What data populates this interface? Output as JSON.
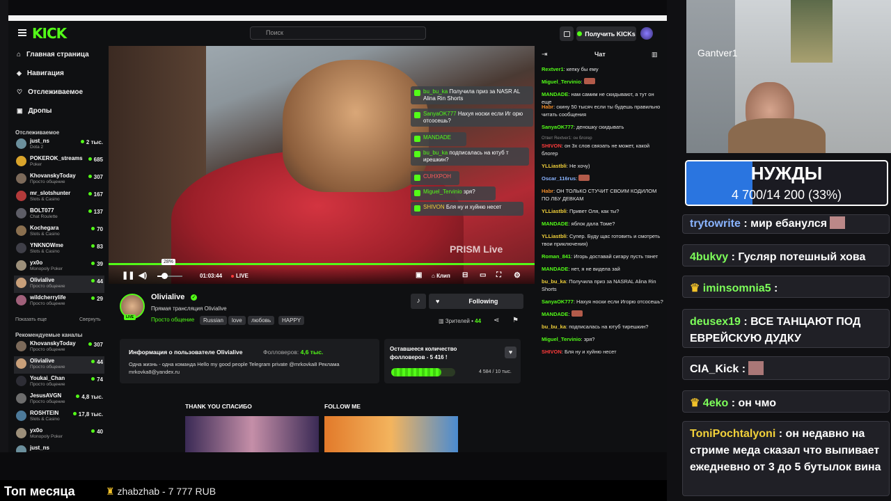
{
  "header": {
    "logo": "KICK",
    "search_placeholder": "Поиск",
    "get_kicks": "Получить KICKs"
  },
  "nav": [
    {
      "label": "Главная страница",
      "icon": "home-icon"
    },
    {
      "label": "Навигация",
      "icon": "compass-icon"
    },
    {
      "label": "Отслеживаемое",
      "icon": "heart-icon"
    },
    {
      "label": "Дропы",
      "icon": "gift-icon"
    }
  ],
  "followed_title": "Отслеживаемое",
  "followed": [
    {
      "name": "just_ns",
      "game": "Dota 2",
      "viewers": "2 тыс."
    },
    {
      "name": "POKEROK_streams",
      "game": "Poker",
      "viewers": "685"
    },
    {
      "name": "KhovanskyToday",
      "game": "Просто общение",
      "viewers": "307"
    },
    {
      "name": "mr_slotshunter",
      "game": "Slots & Casino",
      "viewers": "167"
    },
    {
      "name": "BOLT077",
      "game": "Chat Roulette",
      "viewers": "137"
    },
    {
      "name": "Kochegara",
      "game": "Slots & Casino",
      "viewers": "70"
    },
    {
      "name": "YNKNOWme",
      "game": "Slots & Casino",
      "viewers": "83"
    },
    {
      "name": "yx0o",
      "game": "Monopoly Poker",
      "viewers": "39"
    },
    {
      "name": "Olivialive",
      "game": "Просто общение",
      "viewers": "44"
    },
    {
      "name": "wildcherrylife",
      "game": "Просто общение",
      "viewers": "29"
    }
  ],
  "show_more": "Показать еще",
  "collapse": "Свернуть",
  "recommended_title": "Рекомендуемые каналы",
  "recommended": [
    {
      "name": "KhovanskyToday",
      "game": "Просто общение",
      "viewers": "307"
    },
    {
      "name": "Olivialive",
      "game": "Просто общение",
      "viewers": "44"
    },
    {
      "name": "Youkai_Chan",
      "game": "Просто общение",
      "viewers": "74"
    },
    {
      "name": "JesusAVGN",
      "game": "Просто общение",
      "viewers": "4,8 тыс."
    },
    {
      "name": "ROSHTEIN",
      "game": "Slots & Casino",
      "viewers": "17,8 тыс."
    },
    {
      "name": "yx0o",
      "game": "Monopoly Poker",
      "viewers": "40"
    },
    {
      "name": "just_ns",
      "game": "",
      "viewers": ""
    }
  ],
  "overlay_chat": [
    {
      "user": "bu_bu_ka",
      "text": "Получила приз за NASR AL Alina Rin Shorts"
    },
    {
      "user": "SanyaOK777",
      "text": "Нахуя носки если Иг орю отсосешь?"
    },
    {
      "user": "MANDADE",
      "text": ""
    },
    {
      "user": "bu_bu_ka",
      "text": "подписалась на ютуб т ирешкин?"
    },
    {
      "user": "CUHXPOH",
      "text": ""
    },
    {
      "user": "Miguel_Tervinio",
      "text": "зря?"
    },
    {
      "user": "SHIVON",
      "text": "Бля ну и хуйню несет"
    }
  ],
  "player": {
    "volume_tip": "28%",
    "volume_level": 0.28,
    "time": "01:03:44",
    "live": "LIVE",
    "clip": "Клип",
    "watermark": "PRISM Live"
  },
  "channel": {
    "name": "Olivialive",
    "live_badge": "LIVE",
    "title": "Прямая трансляция Olivialive",
    "category": "Просто общение",
    "tags": [
      "Russian",
      "love",
      "любовь",
      "HAPPY"
    ],
    "following": "Following",
    "viewers_label": "Зрителей •",
    "viewers": "44"
  },
  "about": {
    "title": "Информация о пользователе Olivialive",
    "followers_label": "Фолловеров:",
    "followers": "4,6 тыс.",
    "bio": "Одна жизнь - одна команда Hello my good people   Telegram private @mrkovka8 Реклама mrkovka8@yandex.ru"
  },
  "goal_card": {
    "title": "Оставшееся количество фолловеров - 5 416 !",
    "progress": "4 584 / 10 тыс.",
    "fraction": 0.4584
  },
  "panels": [
    "THANK YOU СПАСИБО",
    "FOLLOW ME"
  ],
  "chat": {
    "title": "Чат",
    "messages": [
      {
        "user": "Rextver1",
        "color": "#53fc18",
        "text": "кепку бы ему"
      },
      {
        "user": "Miguel_Tervinio",
        "color": "#53fc18",
        "text": ""
      },
      {
        "user": "MANDADE",
        "color": "#53fc18",
        "text": "нам самим не скидывают, а тут он еще"
      },
      {
        "user": "Habr",
        "color": "#f28c28",
        "text": "скину 50 тысяч если ты будешь правильно читать сообщения"
      },
      {
        "user": "SanyaOK777",
        "color": "#53fc18",
        "text": "деношку скидывать"
      },
      {
        "reply": "Ответ Rextver1: он блогер",
        "user": "SHIVON",
        "color": "#ff3b3b",
        "text": "он 3х слов связать не может, какой блогер"
      },
      {
        "user": "YLLiastbli",
        "color": "#f2d13a",
        "text": "Не хочу)"
      },
      {
        "user": "Oscar_116rus",
        "color": "#8ab4ff",
        "text": ""
      },
      {
        "user": "Habr",
        "color": "#f28c28",
        "text": "ОН ТОЛЬКО СТУЧИТ СВОИМ КОДИЛОМ ПО ЛБУ ДЕВКАМ"
      },
      {
        "user": "YLLiastbli",
        "color": "#f2d13a",
        "text": "Привет Оля, как ты?"
      },
      {
        "user": "MANDADE",
        "color": "#53fc18",
        "text": "яблок дала Томе?"
      },
      {
        "user": "YLLiastbli",
        "color": "#f2d13a",
        "text": "Супер. Буду щас готовить и смотреть твои приключения)"
      },
      {
        "user": "Roman_841",
        "color": "#53fc18",
        "text": "Игорь доставай сигару пусть тянет"
      },
      {
        "user": "MANDADE",
        "color": "#53fc18",
        "text": "нет, я не видела зай"
      },
      {
        "user": "bu_bu_ka",
        "color": "#f2d13a",
        "text": "Получила приз за NASRAL Alina Rin Shorts"
      },
      {
        "user": "SanyaOK777",
        "color": "#53fc18",
        "text": "Нахуя носки если Игорю отсосешь?"
      },
      {
        "user": "MANDADE",
        "color": "#53fc18",
        "text": ""
      },
      {
        "user": "bu_bu_ka",
        "color": "#f2d13a",
        "text": "подписалась на ютуб тирешкин?"
      },
      {
        "user": "Miguel_Tervinio",
        "color": "#53fc18",
        "text": "зря?"
      },
      {
        "user": "SHIVON",
        "color": "#ff3b3b",
        "text": "Бля ну и хуйню несет"
      }
    ]
  },
  "webcam_label": "Gantver1",
  "goal": {
    "title": "НУЖДЫ",
    "progress": "4 700/14 200 (33%)",
    "fraction": 0.33
  },
  "overlay_msgs": [
    {
      "user": "trytowrite",
      "color": "#8ab4ff",
      "text": "мир ебанулся"
    },
    {
      "user": "4bukvy",
      "color": "#7dff5a",
      "text": "Гусляр потешный хова"
    },
    {
      "user": "iminsomnia5",
      "color": "#7dff5a",
      "text": ""
    },
    {
      "user": "deusex19",
      "color": "#7dff5a",
      "text": "ВСЕ ТАНЦАЮТ ПОД ЕВРЕЙСКУЮ ДУДКУ"
    },
    {
      "user": "CIA_Kick",
      "color": "#e6e6e6",
      "text": ""
    },
    {
      "user": "4eko",
      "color": "#7dff5a",
      "text": "он чмо"
    },
    {
      "user": "ToniPochtalyoni",
      "color": "#f2d13a",
      "text": "он недавно на стриме меда сказал что выпивает ежедневно от 3 до 5 бутылок вина"
    }
  ],
  "bottom": {
    "title": "Топ месяца",
    "donor": "zhabzhab - 7 777 RUB"
  }
}
